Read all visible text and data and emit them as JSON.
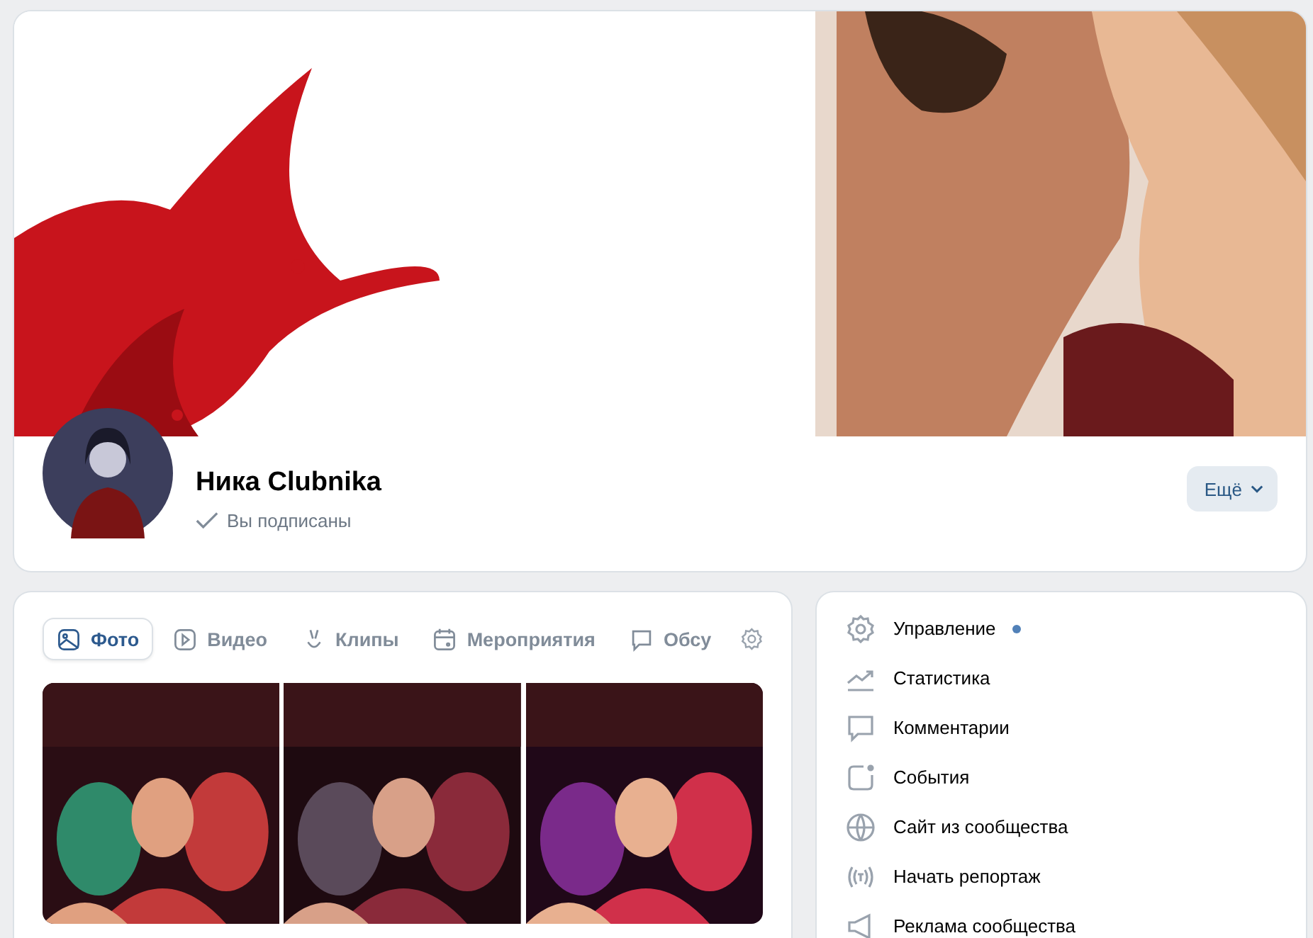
{
  "community": {
    "name": "Ника Clubnika",
    "subscription_status": "Вы подписаны",
    "more_button": "Ещё"
  },
  "media_tabs": [
    {
      "label": "Фото",
      "selected": true
    },
    {
      "label": "Видео",
      "selected": false
    },
    {
      "label": "Клипы",
      "selected": false
    },
    {
      "label": "Мероприятия",
      "selected": false
    },
    {
      "label": "Обсу",
      "selected": false
    }
  ],
  "admin_menu": [
    {
      "label": "Управление",
      "has_dot": true
    },
    {
      "label": "Статистика",
      "has_dot": false
    },
    {
      "label": "Комментарии",
      "has_dot": false
    },
    {
      "label": "События",
      "has_dot": false
    },
    {
      "label": "Сайт из сообщества",
      "has_dot": false
    },
    {
      "label": "Начать репортаж",
      "has_dot": false
    },
    {
      "label": "Реклама сообщества",
      "has_dot": false
    }
  ]
}
